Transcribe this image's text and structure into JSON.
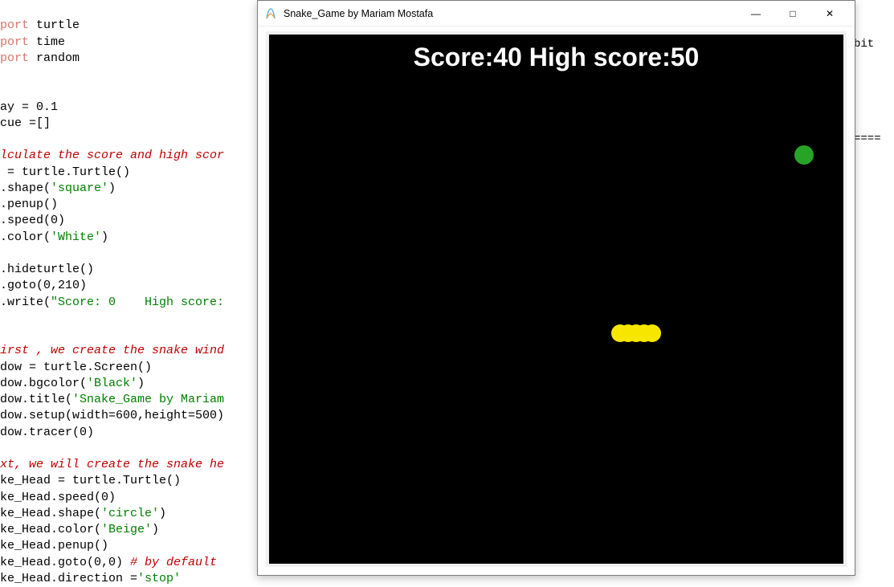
{
  "code": {
    "l0_kw": "port",
    "l0_mod": " turtle",
    "l1_kw": "port",
    "l1_mod": " time",
    "l2_kw": "port",
    "l2_mod": " random",
    "l3": "",
    "l4": "",
    "l5": "ay = 0.1",
    "l6": "cue =[]",
    "l7": "",
    "l8_cmt": "lculate the score and high scor",
    "l9": " = turtle.Turtle()",
    "l10a": ".shape(",
    "l10s": "'square'",
    "l10b": ")",
    "l11": ".penup()",
    "l12": ".speed(0)",
    "l13a": ".color(",
    "l13s": "'White'",
    "l13b": ")",
    "l14": "",
    "l15": ".hideturtle()",
    "l16": ".goto(0,210)",
    "l17a": ".write(",
    "l17s": "\"Score: 0    High score:",
    "l18": "",
    "l19": "",
    "l20_cmt": "irst , we create the snake wind",
    "l21": "dow = turtle.Screen()",
    "l22a": "dow.bgcolor(",
    "l22s": "'Black'",
    "l22b": ")",
    "l23a": "dow.title(",
    "l23s": "'Snake_Game by Mariam",
    "l24": "dow.setup(width=600,height=500)",
    "l25": "dow.tracer(0)",
    "l26": "",
    "l27_cmt": "xt, we will create the snake he",
    "l28": "ke_Head = turtle.Turtle()",
    "l29": "ke_Head.speed(0)",
    "l30a": "ke_Head.shape(",
    "l30s": "'circle'",
    "l30b": ")",
    "l31a": "ke_Head.color(",
    "l31s": "'Beige'",
    "l31b": ")",
    "l32": "ke_Head.penup()",
    "l33a": "ke_Head.goto(0,0) ",
    "l33c": "# by default",
    "l34a": "ke_Head.direction =",
    "l34s": "'stop'"
  },
  "window": {
    "title": "Snake_Game by Mariam Mostafa"
  },
  "win_controls": {
    "min": "—",
    "max": "□",
    "close": "✕"
  },
  "score": {
    "line": "Score:40    High score:50"
  },
  "right_text1": " bit",
  "right_text2": "===="
}
